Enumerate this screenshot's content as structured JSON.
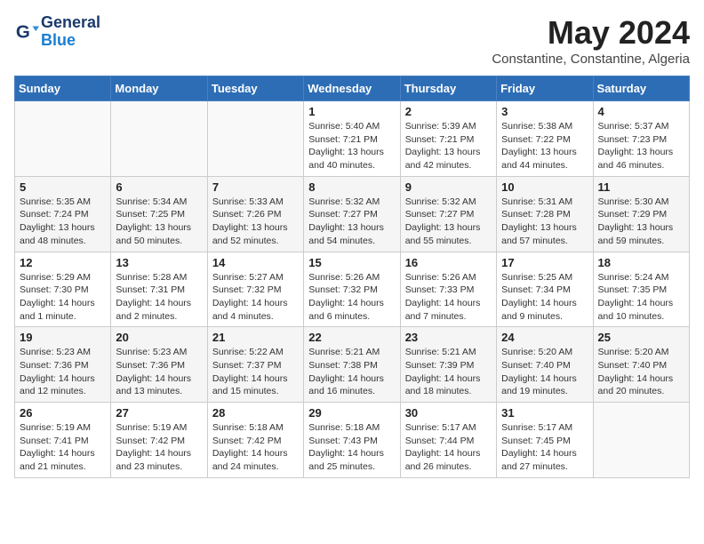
{
  "header": {
    "logo_text_general": "General",
    "logo_text_blue": "Blue",
    "month_title": "May 2024",
    "location": "Constantine, Constantine, Algeria"
  },
  "weekdays": [
    "Sunday",
    "Monday",
    "Tuesday",
    "Wednesday",
    "Thursday",
    "Friday",
    "Saturday"
  ],
  "weeks": [
    [
      {
        "day": "",
        "info": ""
      },
      {
        "day": "",
        "info": ""
      },
      {
        "day": "",
        "info": ""
      },
      {
        "day": "1",
        "info": "Sunrise: 5:40 AM\nSunset: 7:21 PM\nDaylight: 13 hours\nand 40 minutes."
      },
      {
        "day": "2",
        "info": "Sunrise: 5:39 AM\nSunset: 7:21 PM\nDaylight: 13 hours\nand 42 minutes."
      },
      {
        "day": "3",
        "info": "Sunrise: 5:38 AM\nSunset: 7:22 PM\nDaylight: 13 hours\nand 44 minutes."
      },
      {
        "day": "4",
        "info": "Sunrise: 5:37 AM\nSunset: 7:23 PM\nDaylight: 13 hours\nand 46 minutes."
      }
    ],
    [
      {
        "day": "5",
        "info": "Sunrise: 5:35 AM\nSunset: 7:24 PM\nDaylight: 13 hours\nand 48 minutes."
      },
      {
        "day": "6",
        "info": "Sunrise: 5:34 AM\nSunset: 7:25 PM\nDaylight: 13 hours\nand 50 minutes."
      },
      {
        "day": "7",
        "info": "Sunrise: 5:33 AM\nSunset: 7:26 PM\nDaylight: 13 hours\nand 52 minutes."
      },
      {
        "day": "8",
        "info": "Sunrise: 5:32 AM\nSunset: 7:27 PM\nDaylight: 13 hours\nand 54 minutes."
      },
      {
        "day": "9",
        "info": "Sunrise: 5:32 AM\nSunset: 7:27 PM\nDaylight: 13 hours\nand 55 minutes."
      },
      {
        "day": "10",
        "info": "Sunrise: 5:31 AM\nSunset: 7:28 PM\nDaylight: 13 hours\nand 57 minutes."
      },
      {
        "day": "11",
        "info": "Sunrise: 5:30 AM\nSunset: 7:29 PM\nDaylight: 13 hours\nand 59 minutes."
      }
    ],
    [
      {
        "day": "12",
        "info": "Sunrise: 5:29 AM\nSunset: 7:30 PM\nDaylight: 14 hours\nand 1 minute."
      },
      {
        "day": "13",
        "info": "Sunrise: 5:28 AM\nSunset: 7:31 PM\nDaylight: 14 hours\nand 2 minutes."
      },
      {
        "day": "14",
        "info": "Sunrise: 5:27 AM\nSunset: 7:32 PM\nDaylight: 14 hours\nand 4 minutes."
      },
      {
        "day": "15",
        "info": "Sunrise: 5:26 AM\nSunset: 7:32 PM\nDaylight: 14 hours\nand 6 minutes."
      },
      {
        "day": "16",
        "info": "Sunrise: 5:26 AM\nSunset: 7:33 PM\nDaylight: 14 hours\nand 7 minutes."
      },
      {
        "day": "17",
        "info": "Sunrise: 5:25 AM\nSunset: 7:34 PM\nDaylight: 14 hours\nand 9 minutes."
      },
      {
        "day": "18",
        "info": "Sunrise: 5:24 AM\nSunset: 7:35 PM\nDaylight: 14 hours\nand 10 minutes."
      }
    ],
    [
      {
        "day": "19",
        "info": "Sunrise: 5:23 AM\nSunset: 7:36 PM\nDaylight: 14 hours\nand 12 minutes."
      },
      {
        "day": "20",
        "info": "Sunrise: 5:23 AM\nSunset: 7:36 PM\nDaylight: 14 hours\nand 13 minutes."
      },
      {
        "day": "21",
        "info": "Sunrise: 5:22 AM\nSunset: 7:37 PM\nDaylight: 14 hours\nand 15 minutes."
      },
      {
        "day": "22",
        "info": "Sunrise: 5:21 AM\nSunset: 7:38 PM\nDaylight: 14 hours\nand 16 minutes."
      },
      {
        "day": "23",
        "info": "Sunrise: 5:21 AM\nSunset: 7:39 PM\nDaylight: 14 hours\nand 18 minutes."
      },
      {
        "day": "24",
        "info": "Sunrise: 5:20 AM\nSunset: 7:40 PM\nDaylight: 14 hours\nand 19 minutes."
      },
      {
        "day": "25",
        "info": "Sunrise: 5:20 AM\nSunset: 7:40 PM\nDaylight: 14 hours\nand 20 minutes."
      }
    ],
    [
      {
        "day": "26",
        "info": "Sunrise: 5:19 AM\nSunset: 7:41 PM\nDaylight: 14 hours\nand 21 minutes."
      },
      {
        "day": "27",
        "info": "Sunrise: 5:19 AM\nSunset: 7:42 PM\nDaylight: 14 hours\nand 23 minutes."
      },
      {
        "day": "28",
        "info": "Sunrise: 5:18 AM\nSunset: 7:42 PM\nDaylight: 14 hours\nand 24 minutes."
      },
      {
        "day": "29",
        "info": "Sunrise: 5:18 AM\nSunset: 7:43 PM\nDaylight: 14 hours\nand 25 minutes."
      },
      {
        "day": "30",
        "info": "Sunrise: 5:17 AM\nSunset: 7:44 PM\nDaylight: 14 hours\nand 26 minutes."
      },
      {
        "day": "31",
        "info": "Sunrise: 5:17 AM\nSunset: 7:45 PM\nDaylight: 14 hours\nand 27 minutes."
      },
      {
        "day": "",
        "info": ""
      }
    ]
  ]
}
